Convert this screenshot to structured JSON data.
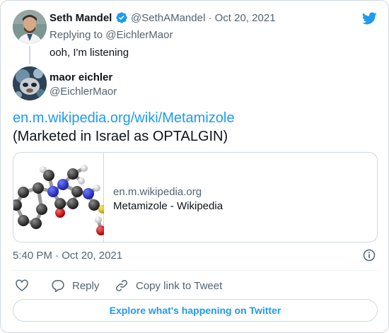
{
  "reply": {
    "author_name": "Seth Mandel",
    "author_handle": "@SethAMandel",
    "separator": "·",
    "date": "Oct 20, 2021",
    "replying_prefix": "Replying to",
    "replying_handle": "@EichlerMaor",
    "text": "ooh, I'm listening",
    "verified_icon": "verified-badge-icon"
  },
  "tweet": {
    "author_name": "maor eichler",
    "author_handle": "@EichlerMaor",
    "link_text": "en.m.wikipedia.org/wiki/Metamizole",
    "body": "(Marketed in Israel as OPTALGIN)",
    "time": "5:40 PM",
    "separator": "·",
    "date": "Oct 20, 2021"
  },
  "link_card": {
    "domain": "en.m.wikipedia.org",
    "title": "Metamizole - Wikipedia",
    "thumbnail": "molecule-ball-and-stick-model"
  },
  "actions": {
    "like_icon": "heart-icon",
    "reply_label": "Reply",
    "copy_label": "Copy link to Tweet"
  },
  "footer": {
    "explore_label": "Explore what's happening on Twitter"
  },
  "colors": {
    "accent": "#1d9bf0",
    "text": "#0f1419",
    "muted": "#536471",
    "border": "#cfd9de"
  }
}
